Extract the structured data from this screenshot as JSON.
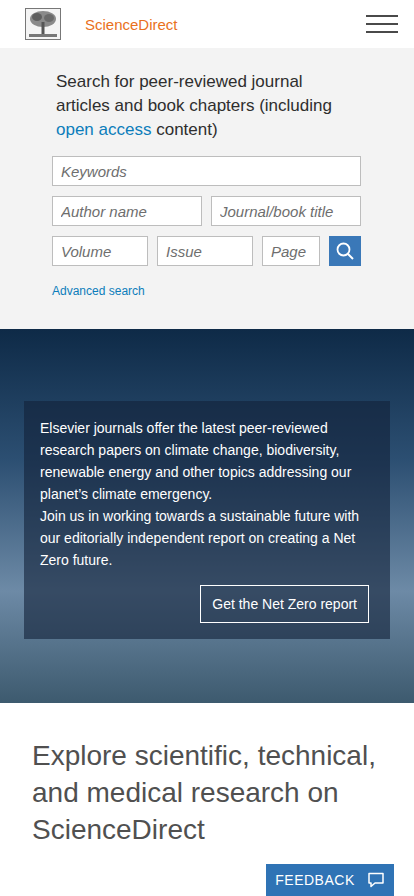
{
  "header": {
    "logo": "ScienceDirect"
  },
  "search": {
    "intro_start": "Search for peer-reviewed journal articles and book chapters (including ",
    "intro_link": "open access",
    "intro_end": " content)",
    "field_rows": [
      [
        "Keywords"
      ],
      [
        "Author name",
        "Journal/book title"
      ],
      [
        "Volume",
        "Issue",
        "Page"
      ]
    ],
    "advanced": "Advanced search"
  },
  "banner": {
    "paragraphs": [
      "Elsevier journals offer the latest peer-reviewed research papers on climate change, biodiversity, renewable energy and other topics addressing our planet’s climate emergency.",
      "Join us in working towards a sustainable future with our editorially independent report on creating a Net Zero future."
    ],
    "button": "Get the Net Zero report"
  },
  "explore": {
    "heading_lines": [
      "Explore scientific, technical,",
      "and medical research on",
      "ScienceDirect"
    ]
  },
  "feedback": "FEEDBACK"
}
